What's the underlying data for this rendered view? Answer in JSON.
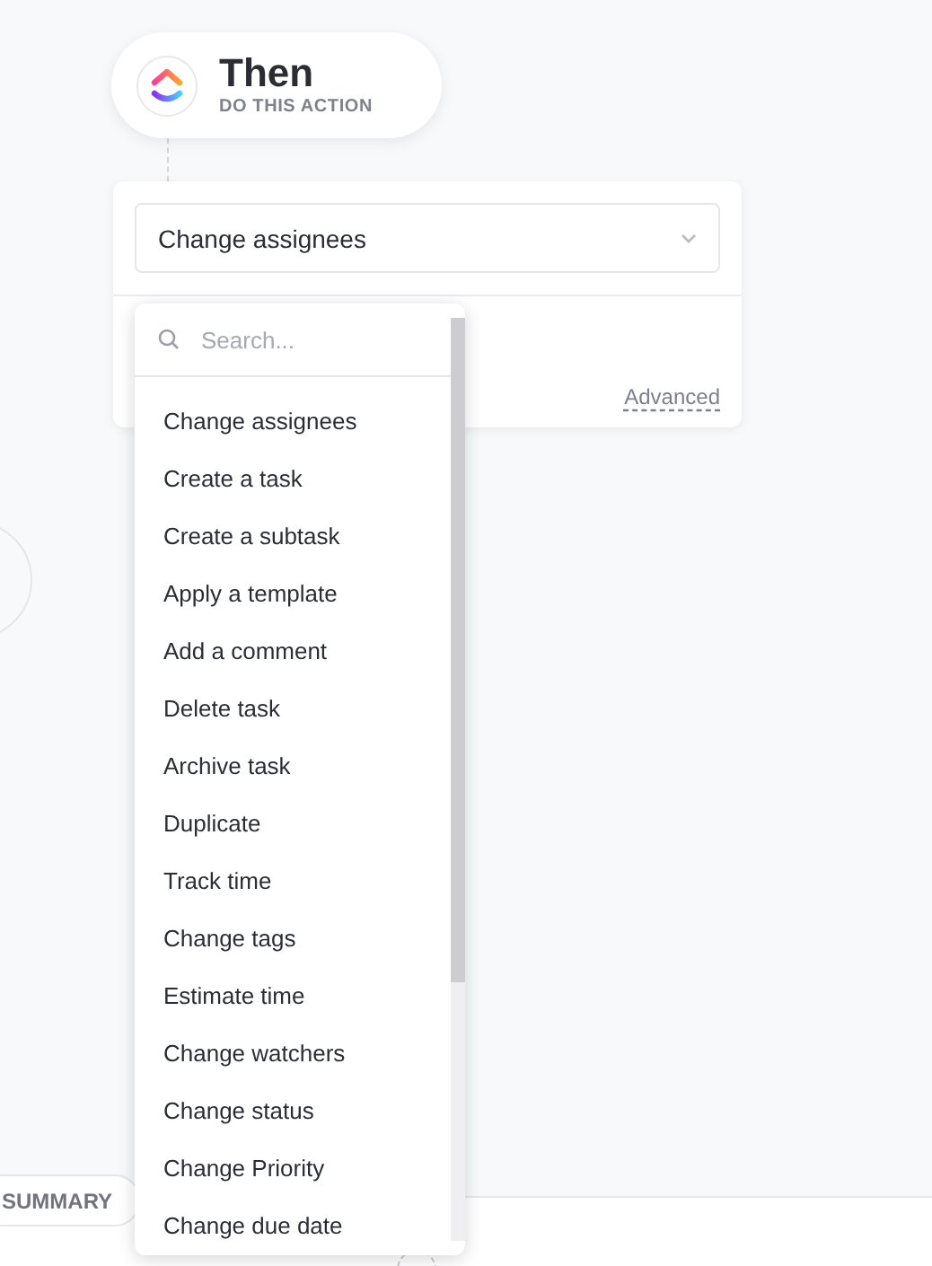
{
  "header": {
    "title": "Then",
    "subtitle": "DO THIS ACTION"
  },
  "action_select": {
    "value": "Change assignees"
  },
  "advanced_link": "Advanced",
  "menu": {
    "search": {
      "placeholder": "Search..."
    },
    "items": [
      {
        "label": "Change assignees"
      },
      {
        "label": "Create a task"
      },
      {
        "label": "Create a subtask"
      },
      {
        "label": "Apply a template"
      },
      {
        "label": "Add a comment"
      },
      {
        "label": "Delete task"
      },
      {
        "label": "Archive task"
      },
      {
        "label": "Duplicate"
      },
      {
        "label": "Track time"
      },
      {
        "label": "Change tags"
      },
      {
        "label": "Estimate time"
      },
      {
        "label": "Change watchers"
      },
      {
        "label": "Change status"
      },
      {
        "label": "Change Priority"
      },
      {
        "label": "Change due date"
      }
    ]
  },
  "footer": {
    "tab": "SUMMARY"
  }
}
